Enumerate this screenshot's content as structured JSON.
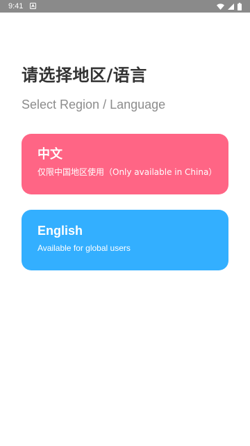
{
  "status_bar": {
    "time": "9:41",
    "notification_icon": "android-debug-icon",
    "wifi_icon": "wifi-icon",
    "signal_icon": "cell-signal-icon",
    "battery_icon": "battery-icon"
  },
  "header": {
    "title": "请选择地区/语言",
    "subtitle": "Select Region / Language"
  },
  "options": [
    {
      "title": "中文",
      "description": "仅限中国地区使用（Only available in China）",
      "color": "#ff6585"
    },
    {
      "title": "English",
      "description": "Available for global users",
      "color": "#33afff"
    }
  ]
}
